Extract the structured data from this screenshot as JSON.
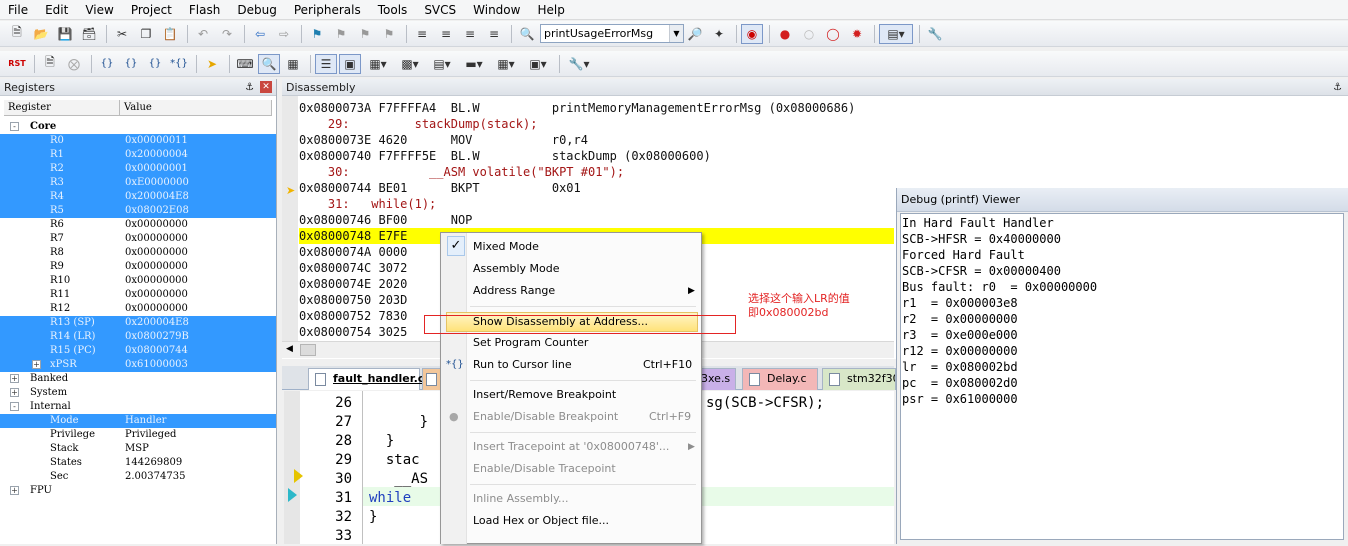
{
  "menubar": {
    "items": [
      "File",
      "Edit",
      "View",
      "Project",
      "Flash",
      "Debug",
      "Peripherals",
      "Tools",
      "SVCS",
      "Window",
      "Help"
    ]
  },
  "toolbar1": {
    "find_value": "printUsageErrorMsg"
  },
  "toolbar2": {
    "rst_label": "RST"
  },
  "registers": {
    "title": "Registers",
    "col_register": "Register",
    "col_value": "Value",
    "core_label": "Core",
    "core": [
      {
        "name": "R0",
        "value": "0x00000011"
      },
      {
        "name": "R1",
        "value": "0x20000004"
      },
      {
        "name": "R2",
        "value": "0x00000001"
      },
      {
        "name": "R3",
        "value": "0xE0000000"
      },
      {
        "name": "R4",
        "value": "0x200004E8"
      },
      {
        "name": "R5",
        "value": "0x08002E08"
      },
      {
        "name": "R6",
        "value": "0x00000000"
      },
      {
        "name": "R7",
        "value": "0x00000000"
      },
      {
        "name": "R8",
        "value": "0x00000000"
      },
      {
        "name": "R9",
        "value": "0x00000000"
      },
      {
        "name": "R10",
        "value": "0x00000000"
      },
      {
        "name": "R11",
        "value": "0x00000000"
      },
      {
        "name": "R12",
        "value": "0x00000000"
      },
      {
        "name": "R13 (SP)",
        "value": "0x200004E8"
      },
      {
        "name": "R14 (LR)",
        "value": "0x0800279B"
      },
      {
        "name": "R15 (PC)",
        "value": "0x08000744"
      },
      {
        "name": "xPSR",
        "value": "0x61000003"
      }
    ],
    "banked_label": "Banked",
    "system_label": "System",
    "internal_label": "Internal",
    "internal": [
      {
        "name": "Mode",
        "value": "Handler"
      },
      {
        "name": "Privilege",
        "value": "Privileged"
      },
      {
        "name": "Stack",
        "value": "MSP"
      },
      {
        "name": "States",
        "value": "144269809"
      },
      {
        "name": "Sec",
        "value": "2.00374735"
      }
    ],
    "fpu_label": "FPU"
  },
  "disassembly": {
    "title": "Disassembly",
    "lines": [
      "0x0800073A F7FFFFA4  BL.W          printMemoryManagementErrorMsg (0x08000686)",
      "    29:         stackDump(stack);",
      "0x0800073E 4620      MOV           r0,r4",
      "0x08000740 F7FFFF5E  BL.W          stackDump (0x08000600)",
      "    30:           __ASM volatile(\"BKPT #01\");",
      "0x08000744 BE01      BKPT          0x01",
      "    31:   while(1);",
      "0x08000746 BF00      NOP",
      "0x08000748 E7FE",
      "0x0800074A 0000",
      "0x0800074C 3072",
      "0x0800074E 2020",
      "0x08000750 203D",
      "0x08000752 7830",
      "0x08000754 3025"
    ]
  },
  "tabs": [
    "fault_handler.c",
    "3xe.s",
    "Delay.c",
    "stm32f30"
  ],
  "editor": {
    "lines": [
      {
        "num": "26",
        "code": ""
      },
      {
        "num": "27",
        "code": "      }"
      },
      {
        "num": "28",
        "code": "  }"
      },
      {
        "num": "29",
        "code": "  stac"
      },
      {
        "num": "30",
        "code": "   __AS"
      },
      {
        "num": "31",
        "code": "while"
      },
      {
        "num": "32",
        "code": "}"
      },
      {
        "num": "33",
        "code": ""
      }
    ],
    "line26_tail": "sg(SCB->CFSR);"
  },
  "printf": {
    "title": "Debug (printf) Viewer",
    "lines": [
      "In Hard Fault Handler",
      "SCB->HFSR = 0x40000000",
      "Forced Hard Fault",
      "SCB->CFSR = 0x00000400",
      "Bus fault: r0  = 0x00000000",
      "r1  = 0x000003e8",
      "r2  = 0x00000000",
      "r3  = 0xe000e000",
      "r12 = 0x00000000",
      "lr  = 0x080002bd",
      "pc  = 0x080002d0",
      "psr = 0x61000000"
    ]
  },
  "context_menu": {
    "mixed_mode": "Mixed Mode",
    "assembly_mode": "Assembly Mode",
    "address_range": "Address Range",
    "show_disassembly": "Show Disassembly at Address...",
    "set_program_counter": "Set Program Counter",
    "run_to_cursor": "Run to Cursor line",
    "run_to_cursor_shortcut": "Ctrl+F10",
    "insert_remove_breakpoint": "Insert/Remove Breakpoint",
    "enable_disable_breakpoint": "Enable/Disable Breakpoint",
    "enable_disable_breakpoint_shortcut": "Ctrl+F9",
    "insert_tracepoint": "Insert Tracepoint at '0x08000748'...",
    "enable_disable_tracepoint": "Enable/Disable Tracepoint",
    "inline_assembly": "Inline Assembly...",
    "load_hex": "Load Hex or Object file..."
  },
  "annotation": {
    "text": "选择这个输入LR的值\n即0x080002bd",
    "color": "#e32424"
  },
  "colors": {
    "selection": "#3399ff",
    "current_line": "#ffff00",
    "annotation_red": "#e32424"
  }
}
